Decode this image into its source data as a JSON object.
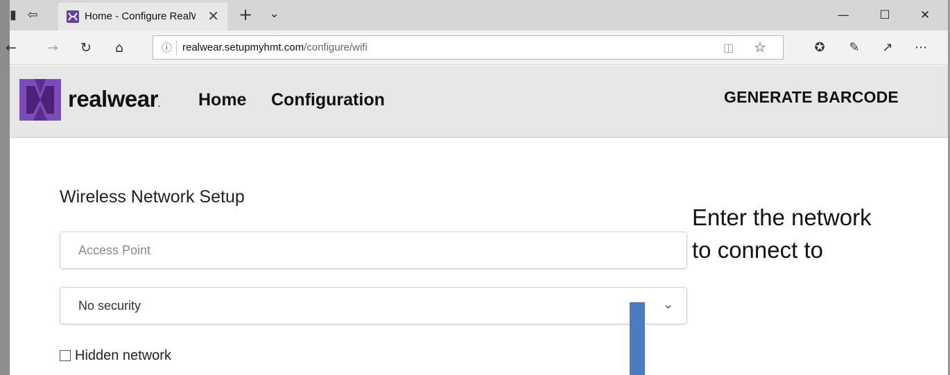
{
  "browser": {
    "tab": {
      "title": "Home - Configure RealWear"
    },
    "address": {
      "host": "realwear.setupmyhmt.com",
      "path": "/configure/wifi"
    },
    "window_controls": {
      "minimize": "—",
      "maximize": "☐",
      "close": "✕"
    }
  },
  "site": {
    "brand": "realwear",
    "brand_mark": ".",
    "nav": [
      {
        "label": "Home"
      },
      {
        "label": "Configuration"
      }
    ],
    "cta": "GENERATE BARCODE"
  },
  "form": {
    "title": "Wireless Network Setup",
    "access_point": {
      "placeholder": "Access Point",
      "value": ""
    },
    "security": {
      "selected": "No security"
    },
    "hidden_network": {
      "label": "Hidden network",
      "checked": false
    }
  },
  "annotation": {
    "line1": "Enter the network",
    "line2": "to connect to"
  },
  "colors": {
    "brand_purple": "#5b2d8e",
    "annotation_bar": "#4a7cbf"
  }
}
